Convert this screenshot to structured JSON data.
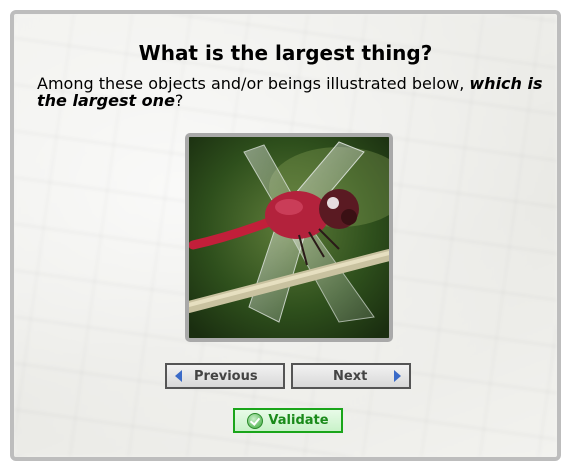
{
  "quiz": {
    "title": "What is the largest thing?",
    "prompt_prefix": "Among these objects and/or beings illustrated below, ",
    "prompt_emphasis": "which is the largest one",
    "prompt_suffix": "?"
  },
  "image": {
    "subject": "dragonfly on twig"
  },
  "navigation": {
    "previous_label": "Previous",
    "next_label": "Next",
    "validate_label": "Validate"
  },
  "icons": {
    "previous": "triangle-left-icon",
    "next": "triangle-right-icon",
    "validate": "check-circle-icon"
  },
  "colors": {
    "validate_accent": "#1aa51a",
    "arrow_blue": "#3a6ac8",
    "frame_gray": "#bdbdbd"
  }
}
